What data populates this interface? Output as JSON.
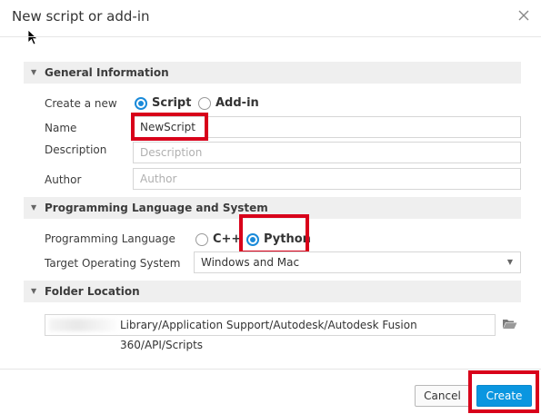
{
  "dialog": {
    "title": "New script or add-in"
  },
  "general": {
    "header": "General Information",
    "create_label": "Create a new",
    "option_script": "Script",
    "option_addin": "Add-in",
    "selected_type": "Script",
    "name_label": "Name",
    "name_value": "NewScript",
    "description_label": "Description",
    "description_placeholder": "Description",
    "author_label": "Author",
    "author_placeholder": "Author"
  },
  "programming": {
    "header": "Programming Language and System",
    "language_label": "Programming Language",
    "option_cpp": "C++",
    "option_python": "Python",
    "selected_language": "Python",
    "os_label": "Target Operating System",
    "os_value": "Windows and Mac"
  },
  "folder": {
    "header": "Folder Location",
    "path": "Library/Application Support/Autodesk/Autodesk Fusion 360/API/Scripts"
  },
  "footer": {
    "cancel_label": "Cancel",
    "create_label": "Create"
  },
  "colors": {
    "accent": "#0a96e0",
    "highlight": "#d8001a",
    "section_bg": "#efefef"
  },
  "icons": {
    "close": "close-icon",
    "cursor": "mouse-pointer-icon",
    "caret": "caret-down-icon",
    "folder": "folder-open-icon"
  }
}
